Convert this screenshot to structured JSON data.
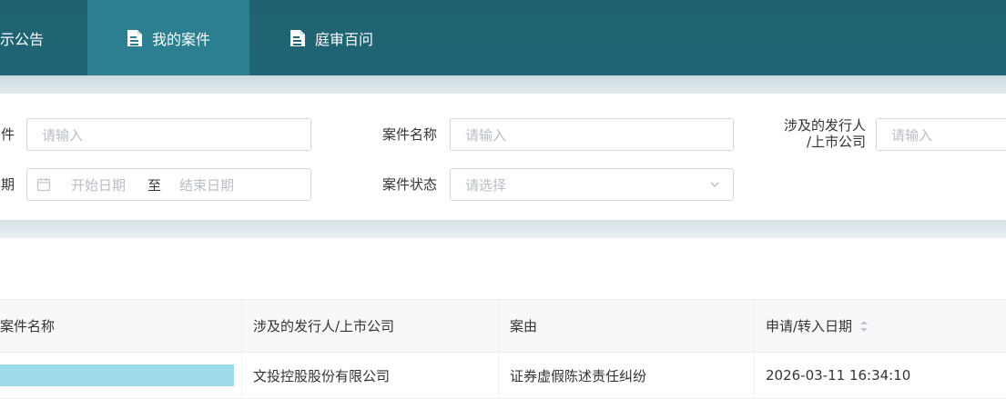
{
  "nav": {
    "items": [
      {
        "label": "示公告",
        "active": false
      },
      {
        "label": "我的案件",
        "active": true
      },
      {
        "label": "庭审百问",
        "active": false
      }
    ]
  },
  "search": {
    "row1": {
      "label_a": "件",
      "placeholder_a": "请输入",
      "label_b": "案件名称",
      "placeholder_b": "请输入",
      "label_c_line1": "涉及的发行人",
      "label_c_line2": "/上市公司",
      "placeholder_c": "请输入"
    },
    "row2": {
      "label_a": "期",
      "date_start": "开始日期",
      "date_sep": "至",
      "date_end": "结束日期",
      "label_b": "案件状态",
      "select_placeholder": "请选择"
    }
  },
  "table": {
    "headers": [
      "案件名称",
      "涉及的发行人/上市公司",
      "案由",
      "申请/转入日期"
    ],
    "rows": [
      {
        "company": "文投控股股份有限公司",
        "cause": "证券虚假陈述责任纠纷",
        "date": "2026-03-11 16:34:10"
      }
    ]
  },
  "colors": {
    "nav_bg": "#206272",
    "nav_active": "#2b7f91",
    "band": "#dbe6ea",
    "redaction": "#9ddbe9"
  }
}
